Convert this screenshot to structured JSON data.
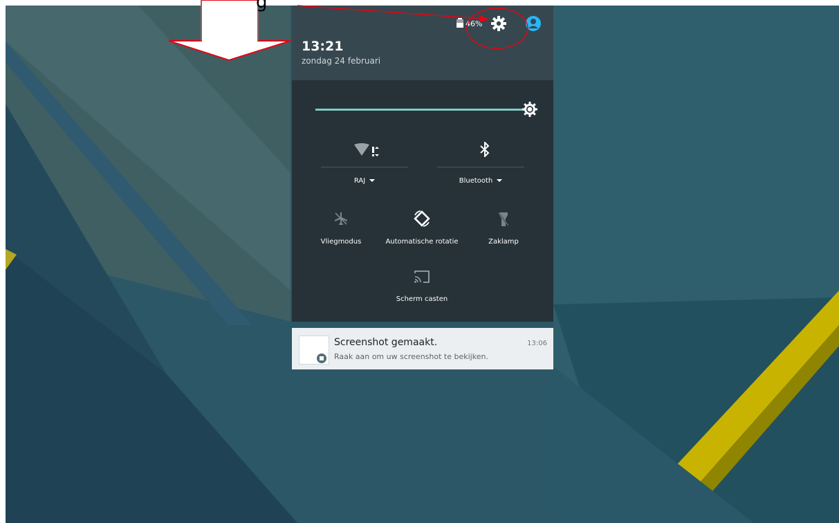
{
  "status_bar": {
    "battery_percent": "46%",
    "icons": [
      "battery-icon",
      "settings-gear-icon",
      "user-avatar-icon"
    ]
  },
  "header": {
    "time": "13:21",
    "date": "zondag 24 februari"
  },
  "quick_settings": {
    "brightness_level": 1.0,
    "wifi": {
      "label": "RAJ",
      "icon": "wifi-no-internet-icon"
    },
    "bluetooth": {
      "label": "Bluetooth",
      "icon": "bluetooth-icon"
    },
    "tiles": [
      {
        "label": "Vliegmodus",
        "icon": "airplane-mode-icon",
        "active": false
      },
      {
        "label": "Automatische rotatie",
        "icon": "auto-rotate-icon",
        "active": true
      },
      {
        "label": "Zaklamp",
        "icon": "flashlight-icon",
        "active": false
      },
      {
        "label": "Scherm casten",
        "icon": "cast-icon",
        "active": false
      }
    ]
  },
  "notification": {
    "title": "Screenshot gemaakt.",
    "time": "13:06",
    "text": "Raak aan om uw screenshot te bekijken.",
    "icon": "screenshot-icon"
  },
  "annotation": {
    "partial_text": "g",
    "color": "#e30613"
  },
  "colors": {
    "shade_header": "#37474f",
    "shade_body": "#263238",
    "accent": "#80cbc4",
    "annotation_red": "#e30613",
    "wallpaper_yellow": "#c8b400"
  }
}
